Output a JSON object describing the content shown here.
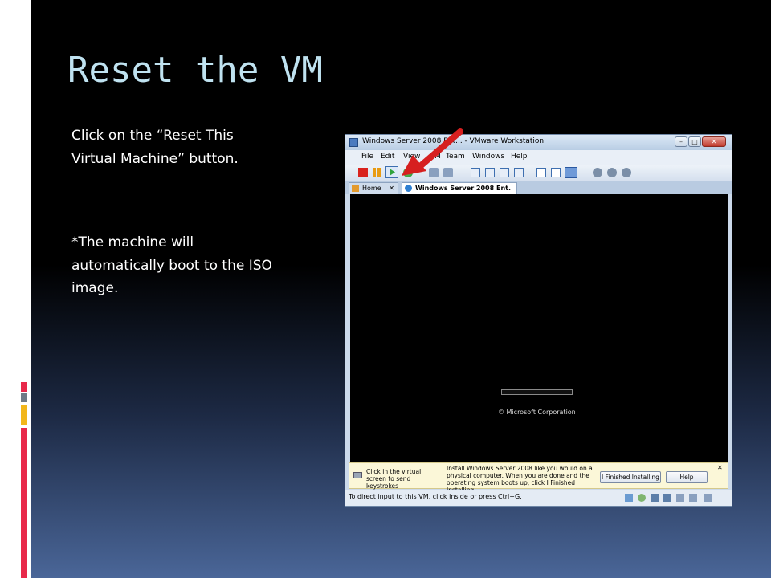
{
  "slide": {
    "title": "Reset the VM",
    "instruction": "Click on the “Reset This Virtual Machine” button.",
    "note": "*The machine will automatically boot to the ISO image."
  },
  "colors": {
    "title": "#bfe2f0",
    "accent_red": "#e8294a",
    "accent_gray": "#6f7a86",
    "accent_yellow": "#f2b61a",
    "arrow_red": "#d61f1f"
  },
  "window": {
    "title": "Windows Server 2008 Ent... - VMware Workstation",
    "controls": [
      "–",
      "□",
      "✕"
    ],
    "menu": [
      "File",
      "Edit",
      "View",
      "VM",
      "Team",
      "Windows",
      "Help"
    ],
    "tabs": [
      {
        "label": "Home",
        "close": "✕"
      },
      {
        "label": "Windows Server 2008 Ent."
      }
    ],
    "screen": {
      "copyright": "© Microsoft Corporation"
    },
    "infobar": {
      "hint": "Click in the virtual screen to send keystrokes",
      "message": "Install Windows Server 2008 like you would on a physical computer. When you are done and the operating system boots up, click I Finished Installing.",
      "primary_button": "I Finished Installing",
      "help_button": "Help",
      "close": "✕"
    },
    "status": "To direct input to this VM, click inside or press Ctrl+G."
  }
}
